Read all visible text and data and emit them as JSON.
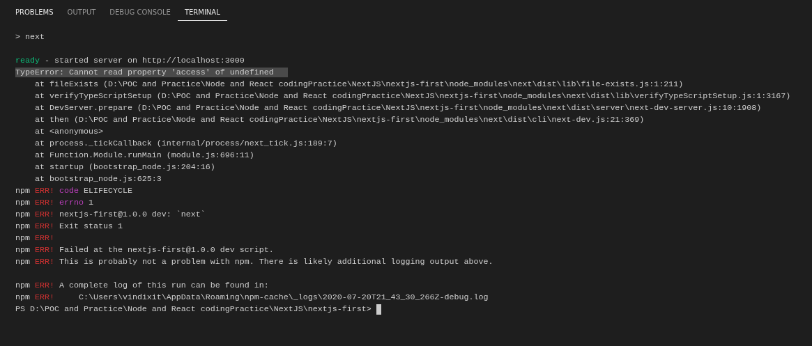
{
  "tabs": [
    {
      "label": "PROBLEMS",
      "selected": false,
      "hovered": true
    },
    {
      "label": "OUTPUT",
      "selected": false,
      "hovered": false
    },
    {
      "label": "DEBUG CONSOLE",
      "selected": false,
      "hovered": false
    },
    {
      "label": "TERMINAL",
      "selected": true,
      "hovered": false
    }
  ],
  "terminal": {
    "lines": [
      {
        "kind": "text",
        "segments": [
          {
            "text": "> next",
            "kind": "plain"
          }
        ]
      },
      {
        "kind": "blank"
      },
      {
        "kind": "text",
        "segments": [
          {
            "text": "ready",
            "kind": "success"
          },
          {
            "text": " - started server on http://localhost:3000",
            "kind": "plain"
          }
        ]
      },
      {
        "kind": "text",
        "segments": [
          {
            "text": "TypeError: Cannot read property 'access' of undefined",
            "kind": "selection"
          }
        ]
      },
      {
        "kind": "text",
        "segments": [
          {
            "text": "    at fileExists (D:\\POC and Practice\\Node and React codingPractice\\NextJS\\nextjs-first\\node_modules\\next\\dist\\lib\\file-exists.js:1:211)",
            "kind": "plain"
          }
        ]
      },
      {
        "kind": "text",
        "segments": [
          {
            "text": "    at verifyTypeScriptSetup (D:\\POC and Practice\\Node and React codingPractice\\NextJS\\nextjs-first\\node_modules\\next\\dist\\lib\\verifyTypeScriptSetup.js:1:3167)",
            "kind": "plain"
          }
        ]
      },
      {
        "kind": "text",
        "segments": [
          {
            "text": "    at DevServer.prepare (D:\\POC and Practice\\Node and React codingPractice\\NextJS\\nextjs-first\\node_modules\\next\\dist\\server\\next-dev-server.js:10:1908)",
            "kind": "plain"
          }
        ]
      },
      {
        "kind": "text",
        "segments": [
          {
            "text": "    at then (D:\\POC and Practice\\Node and React codingPractice\\NextJS\\nextjs-first\\node_modules\\next\\dist\\cli\\next-dev.js:21:369)",
            "kind": "plain"
          }
        ]
      },
      {
        "kind": "text",
        "segments": [
          {
            "text": "    at <anonymous>",
            "kind": "plain"
          }
        ]
      },
      {
        "kind": "text",
        "segments": [
          {
            "text": "    at process._tickCallback (internal/process/next_tick.js:189:7)",
            "kind": "plain"
          }
        ]
      },
      {
        "kind": "text",
        "segments": [
          {
            "text": "    at Function.Module.runMain (module.js:696:11)",
            "kind": "plain"
          }
        ]
      },
      {
        "kind": "text",
        "segments": [
          {
            "text": "    at startup (bootstrap_node.js:204:16)",
            "kind": "plain"
          }
        ]
      },
      {
        "kind": "text",
        "segments": [
          {
            "text": "    at bootstrap_node.js:625:3",
            "kind": "plain"
          }
        ]
      },
      {
        "kind": "text",
        "segments": [
          {
            "text": "npm ",
            "kind": "plain"
          },
          {
            "text": "ERR! ",
            "kind": "error"
          },
          {
            "text": "code",
            "kind": "keyword"
          },
          {
            "text": " ELIFECYCLE",
            "kind": "plain"
          }
        ]
      },
      {
        "kind": "text",
        "segments": [
          {
            "text": "npm ",
            "kind": "plain"
          },
          {
            "text": "ERR! ",
            "kind": "error"
          },
          {
            "text": "errno",
            "kind": "keyword"
          },
          {
            "text": " 1",
            "kind": "plain"
          }
        ]
      },
      {
        "kind": "text",
        "segments": [
          {
            "text": "npm ",
            "kind": "plain"
          },
          {
            "text": "ERR!",
            "kind": "error"
          },
          {
            "text": " nextjs-first@1.0.0 dev: `next`",
            "kind": "plain"
          }
        ]
      },
      {
        "kind": "text",
        "segments": [
          {
            "text": "npm ",
            "kind": "plain"
          },
          {
            "text": "ERR!",
            "kind": "error"
          },
          {
            "text": " Exit status 1",
            "kind": "plain"
          }
        ]
      },
      {
        "kind": "text",
        "segments": [
          {
            "text": "npm ",
            "kind": "plain"
          },
          {
            "text": "ERR!",
            "kind": "error"
          }
        ]
      },
      {
        "kind": "text",
        "segments": [
          {
            "text": "npm ",
            "kind": "plain"
          },
          {
            "text": "ERR!",
            "kind": "error"
          },
          {
            "text": " Failed at the nextjs-first@1.0.0 dev script.",
            "kind": "plain"
          }
        ]
      },
      {
        "kind": "text",
        "segments": [
          {
            "text": "npm ",
            "kind": "plain"
          },
          {
            "text": "ERR!",
            "kind": "error"
          },
          {
            "text": " This is probably not a problem with npm. There is likely additional logging output above.",
            "kind": "plain"
          }
        ]
      },
      {
        "kind": "blank"
      },
      {
        "kind": "text",
        "segments": [
          {
            "text": "npm ",
            "kind": "plain"
          },
          {
            "text": "ERR!",
            "kind": "error"
          },
          {
            "text": " A complete log of this run can be found in:",
            "kind": "plain"
          }
        ]
      },
      {
        "kind": "text",
        "segments": [
          {
            "text": "npm ",
            "kind": "plain"
          },
          {
            "text": "ERR!",
            "kind": "error"
          },
          {
            "text": "     C:\\Users\\vindixit\\AppData\\Roaming\\npm-cache\\_logs\\2020-07-20T21_43_30_266Z-debug.log",
            "kind": "plain"
          }
        ]
      },
      {
        "kind": "prompt",
        "segments": [
          {
            "text": "PS D:\\POC and Practice\\Node and React codingPractice\\NextJS\\nextjs-first> ",
            "kind": "plain"
          }
        ]
      }
    ]
  }
}
